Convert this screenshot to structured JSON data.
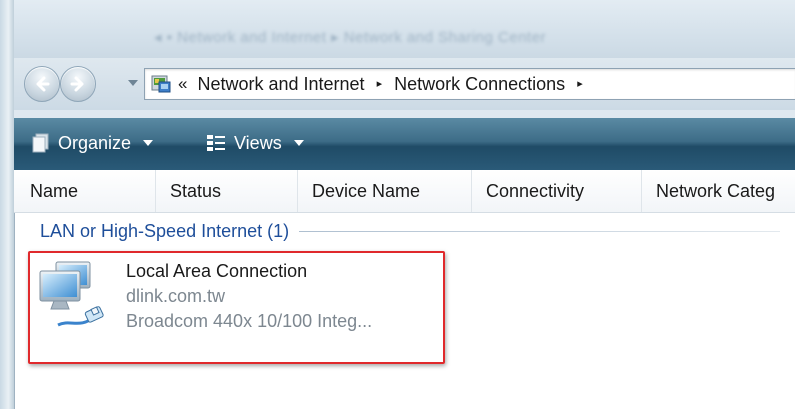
{
  "breadcrumb": {
    "overflow": "«",
    "items": [
      "Network and Internet",
      "Network Connections"
    ],
    "separator": "▸"
  },
  "toolbar": {
    "organize_label": "Organize",
    "views_label": "Views"
  },
  "columns": [
    "Name",
    "Status",
    "Device Name",
    "Connectivity",
    "Network Categ"
  ],
  "group": {
    "label": "LAN or High-Speed Internet (1)"
  },
  "connection": {
    "name": "Local Area Connection",
    "network": "dlink.com.tw",
    "device": "Broadcom 440x 10/100 Integ..."
  },
  "colors": {
    "group_text": "#1e4e9a",
    "highlight_border": "#e0292c",
    "toolbar": "#2a5a78",
    "subtext": "#7d8790"
  },
  "icons": [
    "back-arrow-icon",
    "forward-arrow-icon",
    "control-panel-icon",
    "organize-icon",
    "views-icon",
    "network-connection-icon"
  ]
}
